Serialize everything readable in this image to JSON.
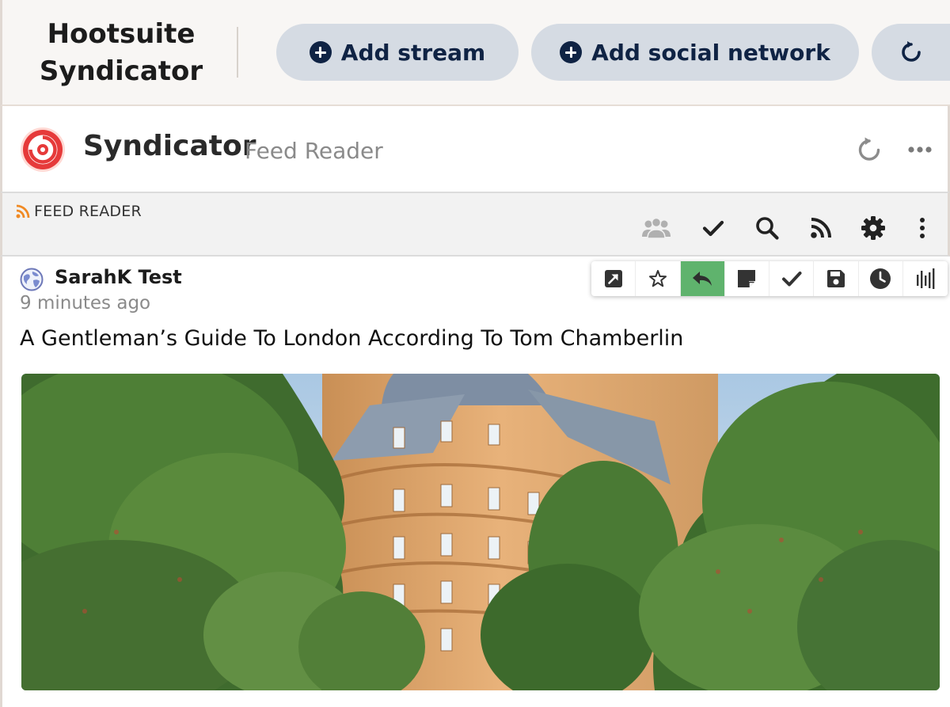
{
  "topbar": {
    "app_title_line1": "Hootsuite",
    "app_title_line2": "Syndicator",
    "add_stream_label": "Add stream",
    "add_social_network_label": "Add social network",
    "icons": [
      "plus-circle-icon",
      "plus-circle-icon",
      "refresh-icon"
    ]
  },
  "stream": {
    "title": "Syndicator",
    "subtitle": "Feed Reader",
    "icons": [
      "syndicator-logo",
      "refresh-icon",
      "more-horizontal-icon"
    ]
  },
  "feed_toolbar": {
    "label": "FEED READER",
    "icons": [
      "rss-icon",
      "team-icon",
      "check-icon",
      "search-icon",
      "rss-icon",
      "gear-icon",
      "more-vertical-icon"
    ]
  },
  "post": {
    "author": "SarahK Test",
    "timestamp": "9 minutes ago",
    "headline": "A Gentleman’s Guide To London According To Tom Chamberlin",
    "actions": [
      "open-external-icon",
      "star-icon",
      "reply-icon",
      "note-icon",
      "check-icon",
      "save-icon",
      "clock-icon",
      "stats-icon"
    ],
    "active_action": "reply-icon"
  },
  "colors": {
    "topbar_bg": "#f8f6f4",
    "pill_bg": "#d5dbe3",
    "pill_text": "#0f2344",
    "active_action": "#5fb36d",
    "rss_orange": "#f08a24",
    "logo_red": "#e63a3a"
  }
}
